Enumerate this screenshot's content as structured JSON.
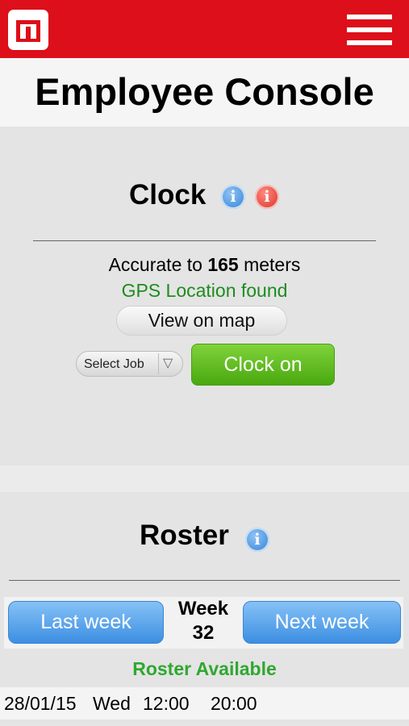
{
  "topbar": {
    "logo_icon": "brand-logo-icon",
    "menu_icon": "hamburger-menu-icon",
    "color": "#dc0f1a"
  },
  "header": {
    "title": "Employee Console"
  },
  "clock": {
    "title": "Clock",
    "accuracy_prefix": "Accurate to ",
    "accuracy_value": "165",
    "accuracy_suffix": " meters",
    "gps_status": "GPS Location found",
    "view_map_label": "View on map",
    "job_select": {
      "selected": "Select Job"
    },
    "clock_on_label": "Clock on"
  },
  "roster": {
    "title": "Roster",
    "last_week_label": "Last week",
    "week_label": "Week",
    "week_number": "32",
    "next_week_label": "Next week",
    "status": "Roster Available",
    "rows": [
      {
        "date": "28/01/15",
        "day": "Wed",
        "start": "12:00",
        "end": "20:00"
      }
    ]
  },
  "colors": {
    "accent": "#dc0f1a",
    "success": "#2fa82f",
    "primary_button": "#4a9be8",
    "clock_button": "#5fbd1f"
  }
}
